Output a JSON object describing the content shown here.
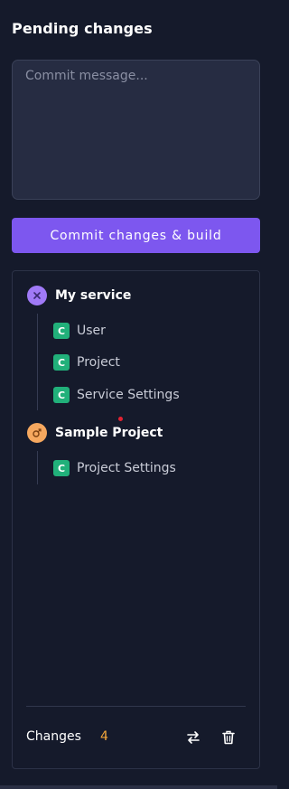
{
  "header": {
    "title": "Pending changes"
  },
  "commit": {
    "placeholder": "Commit message...",
    "button_label": "Commit changes & build"
  },
  "groups": [
    {
      "name": "My service",
      "icon": "service-icon",
      "icon_color": "#a07af7",
      "items": [
        {
          "badge": "C",
          "label": "User"
        },
        {
          "badge": "C",
          "label": "Project"
        },
        {
          "badge": "C",
          "label": "Service Settings"
        }
      ]
    },
    {
      "name": "Sample Project",
      "icon": "project-icon",
      "icon_color": "#f6a85f",
      "items": [
        {
          "badge": "C",
          "label": "Project Settings"
        }
      ]
    }
  ],
  "footer": {
    "label": "Changes",
    "count": "4",
    "count_color": "#f4a73a"
  },
  "colors": {
    "accent": "#7d57ef",
    "badge": "#21b07a",
    "background": "#151a2b"
  }
}
